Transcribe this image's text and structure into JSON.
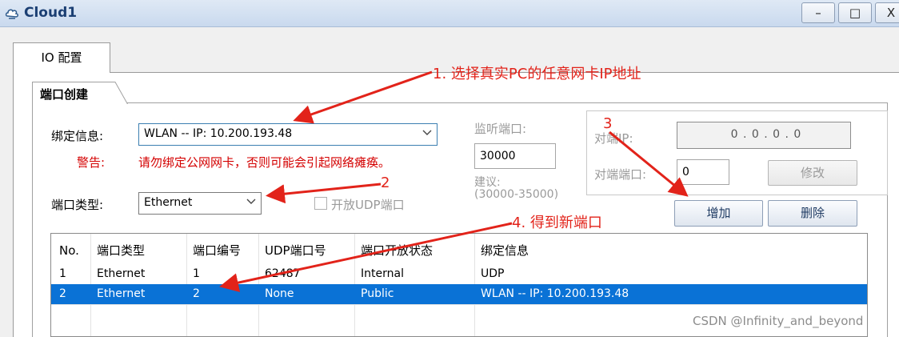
{
  "window": {
    "title": "Cloud1",
    "buttons": {
      "minimize": "–",
      "maximize": "□",
      "close": "X"
    }
  },
  "tabs": {
    "outer": "IO 配置",
    "inner": "端口创建"
  },
  "form": {
    "bind_label": "绑定信息:",
    "bind_value": "WLAN -- IP: 10.200.193.48",
    "warning_label": "警告:",
    "warning_text": "请勿绑定公网网卡，否则可能会引起网络瘫痪。",
    "port_type_label": "端口类型:",
    "port_type_value": "Ethernet",
    "udp_checkbox_label": "开放UDP端口",
    "listen_port_label": "监听端口:",
    "listen_port_value": "30000",
    "suggest_label": "建议:",
    "suggest_range": "(30000-35000)",
    "peer_ip_label": "对端IP:",
    "peer_ip_value": "0 . 0 . 0 . 0",
    "peer_port_label": "对端端口:",
    "peer_port_value": "0",
    "modify_button": "修改",
    "add_button": "增加",
    "delete_button": "删除"
  },
  "table": {
    "columns": [
      "No.",
      "端口类型",
      "端口编号",
      "UDP端口号",
      "端口开放状态",
      "绑定信息"
    ],
    "rows": [
      [
        "1",
        "Ethernet",
        "1",
        "62487",
        "Internal",
        "UDP"
      ],
      [
        "2",
        "Ethernet",
        "2",
        "None",
        "Public",
        "WLAN -- IP: 10.200.193.48"
      ]
    ],
    "selected_row": 2
  },
  "annotations": {
    "step1": "1. 选择真实PC的任意网卡IP地址",
    "step2": "2",
    "step3": "3",
    "step4": "4. 得到新端口",
    "color": "#e2231a"
  },
  "watermark": "CSDN @Infinity_and_beyond"
}
